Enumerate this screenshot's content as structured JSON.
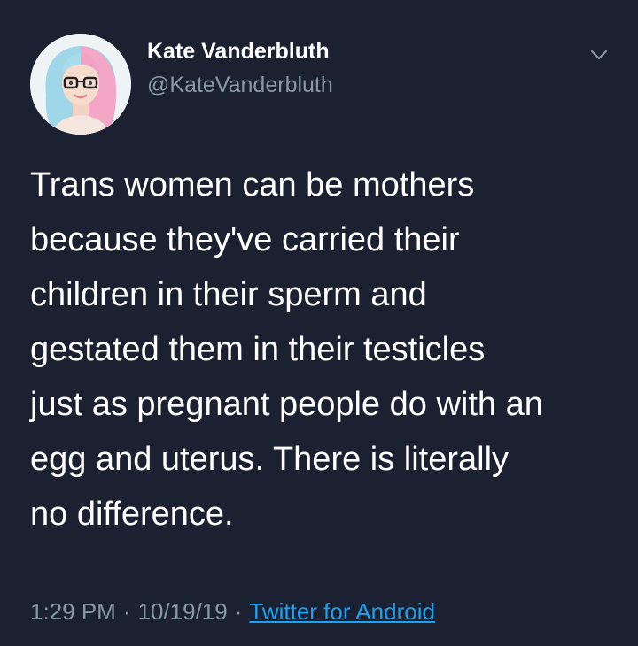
{
  "tweet": {
    "author": {
      "name": "Kate Vanderbluth",
      "handle": "@KateVanderbluth",
      "avatar_icon": "avatar-illustration"
    },
    "menu_icon": "chevron-down-icon",
    "text_lines": [
      "Trans women can be mothers",
      "because they've carried their",
      "children in their sperm and",
      "gestated them in their testicles",
      "just as pregnant people do with an",
      "egg and uterus. There is literally",
      "no difference."
    ],
    "time": "1:29 PM",
    "date": "10/19/19",
    "separator": "·",
    "source": "Twitter for Android"
  },
  "colors": {
    "background": "#1b2130",
    "text": "#ffffff",
    "secondary": "#8899a6",
    "link": "#1da1f2"
  }
}
